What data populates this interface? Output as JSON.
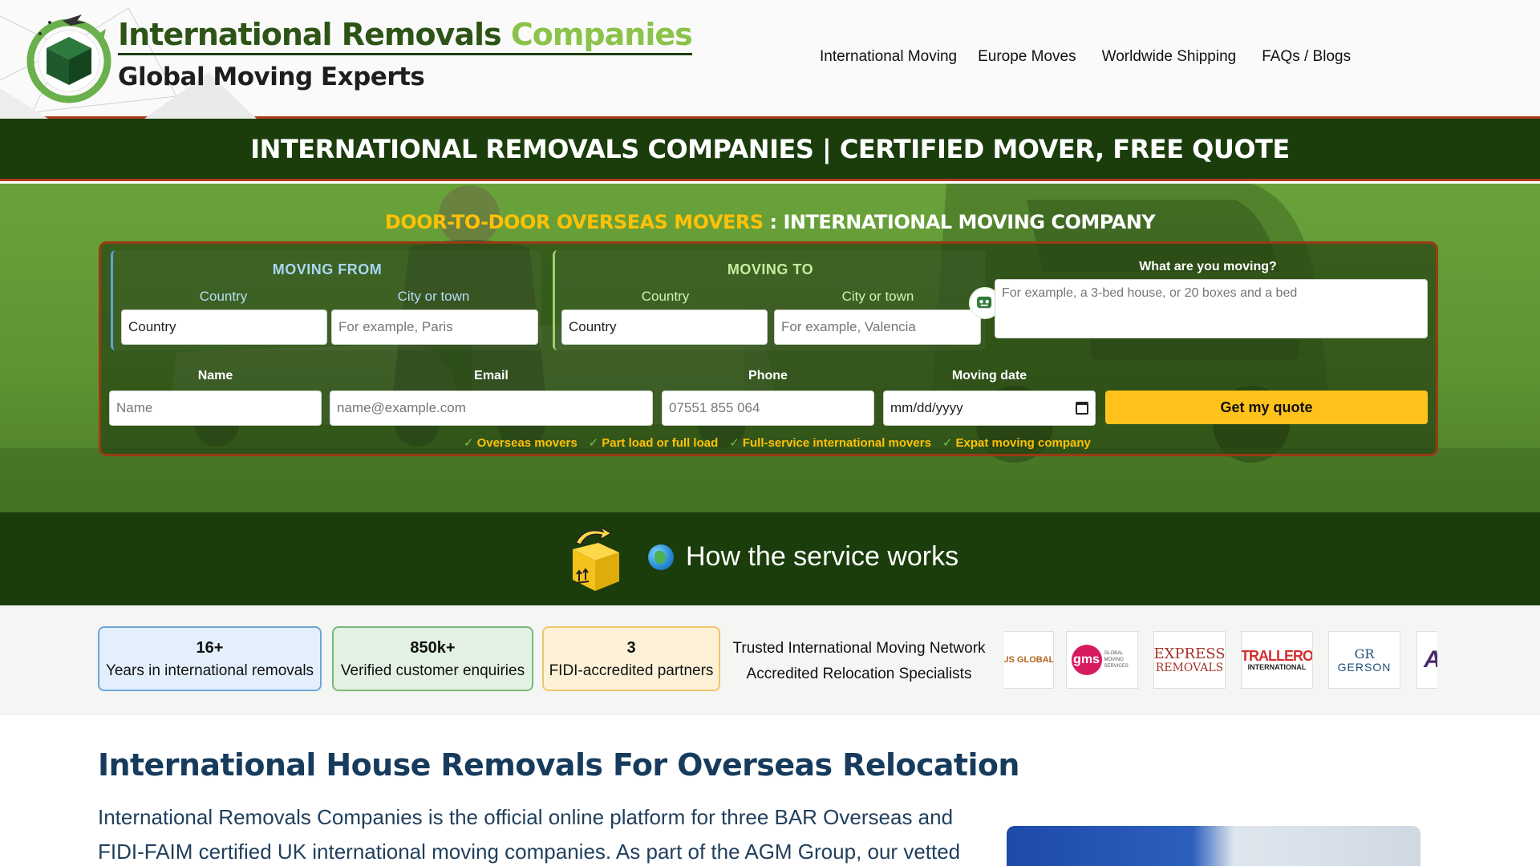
{
  "header": {
    "brand_part1": "International Removals",
    "brand_part2": "Companies",
    "tagline": "Global Moving Experts",
    "nav": [
      "International Moving",
      "Europe Moves",
      "Worldwide Shipping",
      "FAQs / Blogs"
    ]
  },
  "banner": {
    "title": "INTERNATIONAL REMOVALS COMPANIES | CERTIFIED MOVER, FREE QUOTE"
  },
  "hero": {
    "subtitle_highlight": "DOOR-TO-DOOR OVERSEAS MOVERS",
    "subtitle_rest": " : INTERNATIONAL MOVING COMPANY"
  },
  "form": {
    "moving_from": {
      "title": "MOVING FROM",
      "country_label": "Country",
      "city_label": "City or town",
      "country_value": "Country",
      "city_placeholder": "For example, Paris"
    },
    "moving_to": {
      "title": "MOVING TO",
      "country_label": "Country",
      "city_label": "City or town",
      "country_value": "Country",
      "city_placeholder": "For example, Valencia"
    },
    "what_moving": {
      "label": "What are you moving?",
      "placeholder": "For example, a 3-bed house, or 20 boxes and a bed"
    },
    "name": {
      "label": "Name",
      "placeholder": "Name"
    },
    "email": {
      "label": "Email",
      "placeholder": "name@example.com"
    },
    "phone": {
      "label": "Phone",
      "placeholder": "07551 855 064"
    },
    "date": {
      "label": "Moving date",
      "placeholder": "mm/dd/yyyy"
    },
    "submit_label": "Get my quote",
    "features": [
      "Overseas movers",
      "Part load or full load",
      "Full-service international movers",
      "Expat moving company"
    ]
  },
  "how": {
    "text": "How the service works"
  },
  "stats": [
    {
      "value": "16+",
      "label": "Years in international removals"
    },
    {
      "value": "850k+",
      "label": "Verified customer enquiries"
    },
    {
      "value": "3",
      "label": "FIDI-accredited partners"
    }
  ],
  "trusted": {
    "line1": "Trusted International Moving Network",
    "line2": "Accredited Relocation Specialists"
  },
  "partner_logos": {
    "rus": "RUS GLOBAL",
    "gms": "gms",
    "gms_small": "GLOBAL MOVING SERVICES",
    "express1": "EXPRESS",
    "express2": "REMOVALS",
    "trallero1": "TRALLERO",
    "trallero2": "INTERNATIONAL",
    "gerson_mark": "GR",
    "gerson": "GERSON",
    "last": "A"
  },
  "content": {
    "heading": "International House Removals For Overseas Relocation",
    "paragraph": "International Removals Companies is the official online platform for three BAR Overseas and FIDI-FAIM certified UK international moving companies. As part of the AGM Group, our vetted"
  },
  "colors": {
    "brand_dark_green": "#1a3d0b",
    "brand_light_green": "#8bc34a",
    "accent_yellow": "#ffc21a",
    "heading_blue": "#163b5c",
    "divider_red": "#b43a1f"
  }
}
